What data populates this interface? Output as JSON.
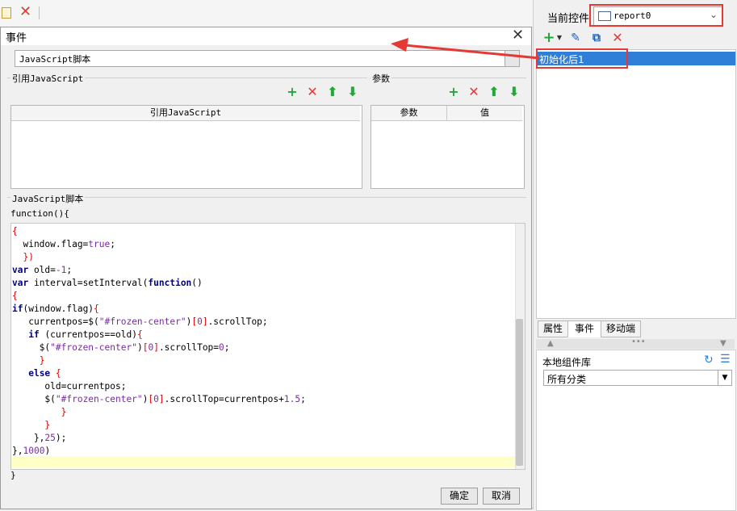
{
  "right_panel": {
    "current_control_label": "当前控件",
    "current_control_value": "report0",
    "event_item": "初始化后1",
    "tabs": [
      "属性",
      "事件",
      "移动端"
    ],
    "library_title": "本地组件库",
    "library_select": "所有分类"
  },
  "dialog": {
    "title": "事件",
    "type_value": "JavaScript脚本",
    "ref_section": "引用JavaScript",
    "params_section": "参数",
    "ref_table_header": "引用JavaScript",
    "params_header_param": "参数",
    "params_header_value": "值",
    "script_section": "JavaScript脚本",
    "function_open": "function(){",
    "function_close": "}",
    "ok_label": "确定",
    "cancel_label": "取消"
  },
  "colors": {
    "accent_red": "#e53935",
    "accent_green": "#22a83a",
    "selection_blue": "#2f7fd8",
    "current_line": "#ffffc8"
  },
  "icons": [
    "add-icon",
    "delete-icon",
    "move-up-icon",
    "move-down-icon",
    "edit-icon",
    "copy-icon",
    "close-icon",
    "refresh-icon",
    "menu-icon"
  ]
}
